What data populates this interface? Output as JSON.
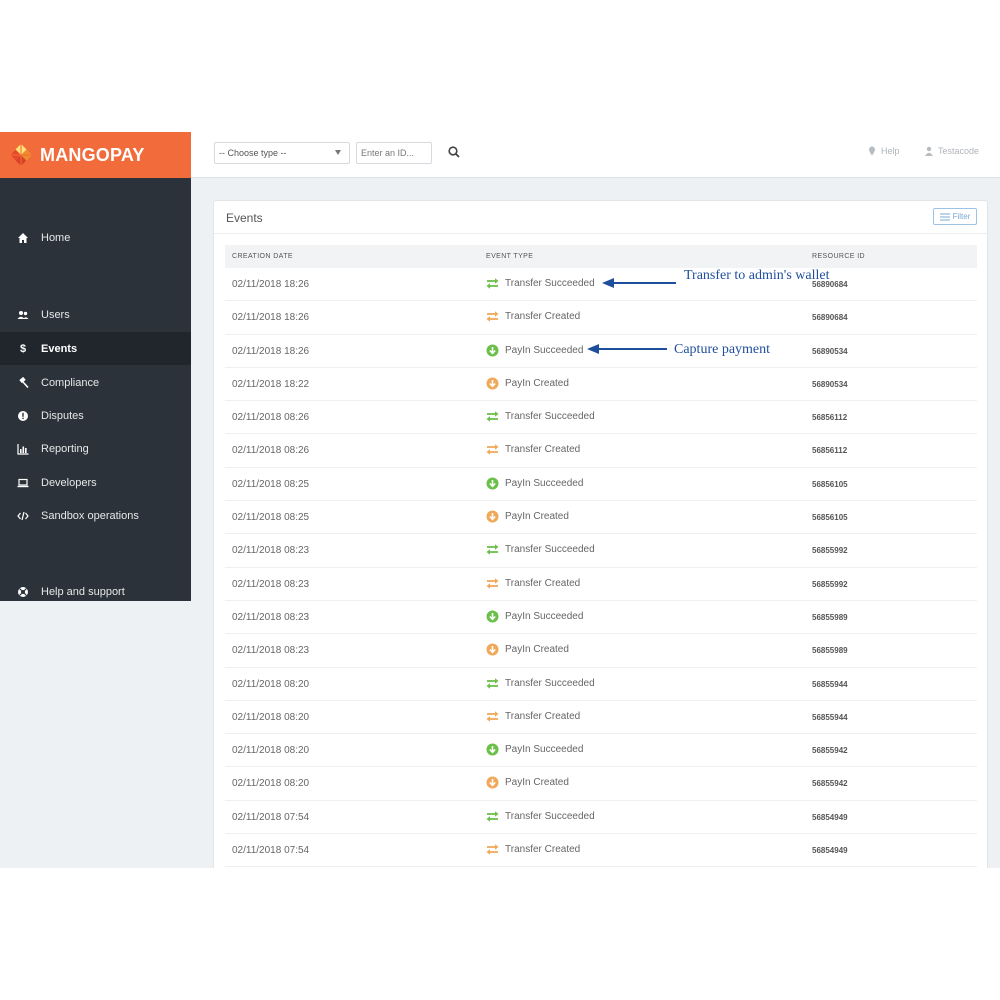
{
  "brand": {
    "name": "MANGOPAY",
    "color": "#f26b3a"
  },
  "sidebar": {
    "items": [
      {
        "label": "Home",
        "icon": "home-icon"
      },
      {
        "label": "Users",
        "icon": "users-icon"
      },
      {
        "label": "Events",
        "icon": "dollar-icon",
        "active": true
      },
      {
        "label": "Compliance",
        "icon": "gavel-icon"
      },
      {
        "label": "Disputes",
        "icon": "alert-circle-icon"
      },
      {
        "label": "Reporting",
        "icon": "bar-chart-icon"
      },
      {
        "label": "Developers",
        "icon": "laptop-icon"
      },
      {
        "label": "Sandbox operations",
        "icon": "code-icon"
      },
      {
        "label": "Help and support",
        "icon": "lifebuoy-icon"
      }
    ]
  },
  "topbar": {
    "type_select": "-- Choose type --",
    "id_placeholder": "Enter an ID...",
    "help": "Help",
    "user": "Testacode"
  },
  "panel": {
    "title": "Events",
    "filter_label": "Filter",
    "columns": [
      "CREATION DATE",
      "EVENT TYPE",
      "RESOURCE ID"
    ],
    "rows": [
      {
        "date": "02/11/2018 18:26",
        "type": "Transfer Succeeded",
        "kind": "transfer",
        "status": "succeeded",
        "resource": "56890684"
      },
      {
        "date": "02/11/2018 18:26",
        "type": "Transfer Created",
        "kind": "transfer",
        "status": "created",
        "resource": "56890684"
      },
      {
        "date": "02/11/2018 18:26",
        "type": "PayIn Succeeded",
        "kind": "payin",
        "status": "succeeded",
        "resource": "56890534"
      },
      {
        "date": "02/11/2018 18:22",
        "type": "PayIn Created",
        "kind": "payin",
        "status": "created",
        "resource": "56890534"
      },
      {
        "date": "02/11/2018 08:26",
        "type": "Transfer Succeeded",
        "kind": "transfer",
        "status": "succeeded",
        "resource": "56856112"
      },
      {
        "date": "02/11/2018 08:26",
        "type": "Transfer Created",
        "kind": "transfer",
        "status": "created",
        "resource": "56856112"
      },
      {
        "date": "02/11/2018 08:25",
        "type": "PayIn Succeeded",
        "kind": "payin",
        "status": "succeeded",
        "resource": "56856105"
      },
      {
        "date": "02/11/2018 08:25",
        "type": "PayIn Created",
        "kind": "payin",
        "status": "created",
        "resource": "56856105"
      },
      {
        "date": "02/11/2018 08:23",
        "type": "Transfer Succeeded",
        "kind": "transfer",
        "status": "succeeded",
        "resource": "56855992"
      },
      {
        "date": "02/11/2018 08:23",
        "type": "Transfer Created",
        "kind": "transfer",
        "status": "created",
        "resource": "56855992"
      },
      {
        "date": "02/11/2018 08:23",
        "type": "PayIn Succeeded",
        "kind": "payin",
        "status": "succeeded",
        "resource": "56855989"
      },
      {
        "date": "02/11/2018 08:23",
        "type": "PayIn Created",
        "kind": "payin",
        "status": "created",
        "resource": "56855989"
      },
      {
        "date": "02/11/2018 08:20",
        "type": "Transfer Succeeded",
        "kind": "transfer",
        "status": "succeeded",
        "resource": "56855944"
      },
      {
        "date": "02/11/2018 08:20",
        "type": "Transfer Created",
        "kind": "transfer",
        "status": "created",
        "resource": "56855944"
      },
      {
        "date": "02/11/2018 08:20",
        "type": "PayIn Succeeded",
        "kind": "payin",
        "status": "succeeded",
        "resource": "56855942"
      },
      {
        "date": "02/11/2018 08:20",
        "type": "PayIn Created",
        "kind": "payin",
        "status": "created",
        "resource": "56855942"
      },
      {
        "date": "02/11/2018 07:54",
        "type": "Transfer Succeeded",
        "kind": "transfer",
        "status": "succeeded",
        "resource": "56854949"
      },
      {
        "date": "02/11/2018 07:54",
        "type": "Transfer Created",
        "kind": "transfer",
        "status": "created",
        "resource": "56854949"
      }
    ]
  },
  "annotations": {
    "transfer_note": "Transfer to admin's wallet",
    "payin_note": "Capture payment",
    "color": "#1f4f9c"
  },
  "colors": {
    "succeeded": "#6cc04a",
    "created": "#f0a85a",
    "sidebar_bg": "#2b3239"
  }
}
